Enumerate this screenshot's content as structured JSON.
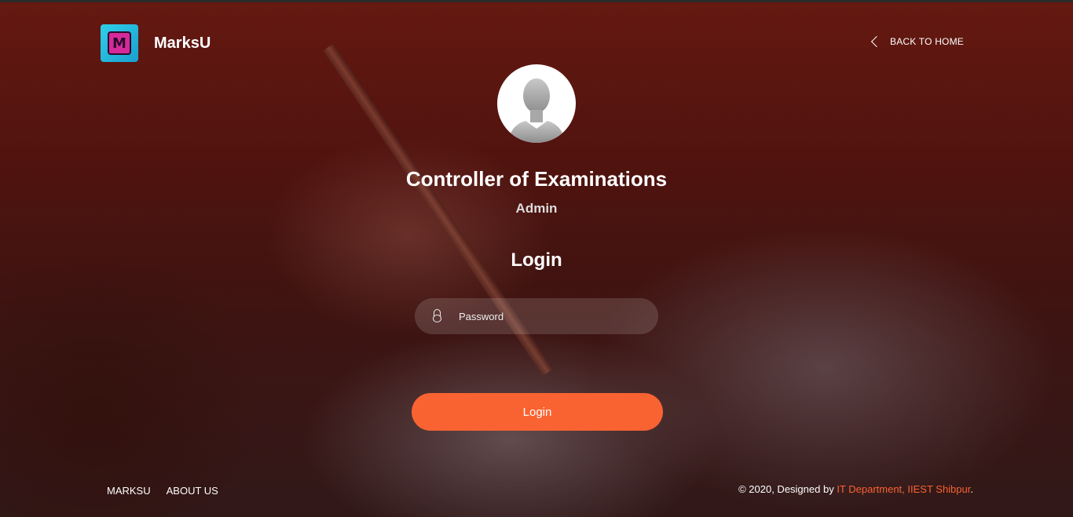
{
  "header": {
    "brand_name": "MarksU",
    "logo_letter": "M",
    "back_home_label": "BACK TO HOME"
  },
  "profile": {
    "title": "Controller of Examinations",
    "role": "Admin"
  },
  "form": {
    "heading": "Login",
    "password_placeholder": "Password",
    "submit_label": "Login"
  },
  "footer": {
    "nav": [
      "MARKSU",
      "ABOUT US"
    ],
    "copyright_prefix": "© 2020, Designed by ",
    "copyright_link": "IT Department, IIEST Shibpur",
    "copyright_suffix": "."
  },
  "colors": {
    "accent": "#f96332",
    "logo_bg": "#2fd0e8",
    "logo_inner": "#d42a9a"
  },
  "icons": [
    "m-logo-icon",
    "chevron-left-icon",
    "user-avatar-icon",
    "lock-icon"
  ]
}
